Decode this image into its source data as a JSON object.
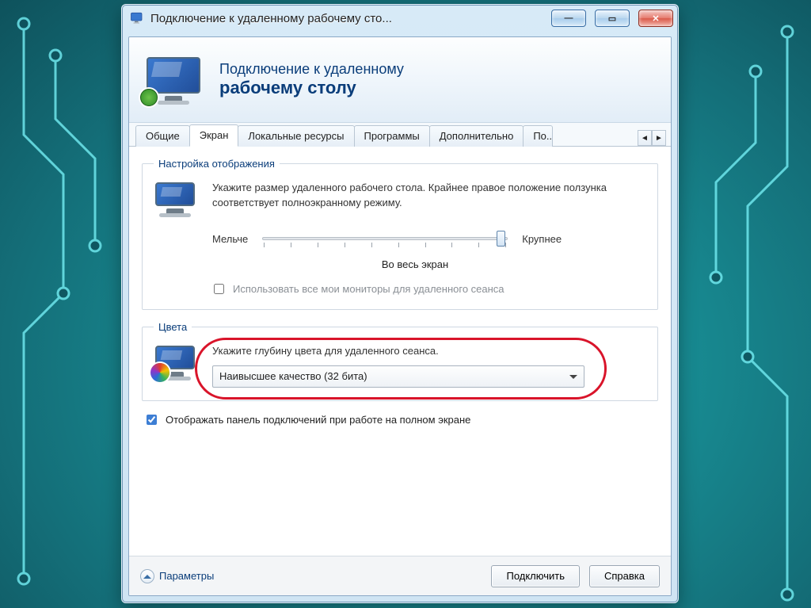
{
  "window": {
    "title": "Подключение к удаленному рабочему сто..."
  },
  "banner": {
    "line1": "Подключение к удаленному",
    "line2": "рабочему столу"
  },
  "tabs": {
    "items": [
      {
        "label": "Общие"
      },
      {
        "label": "Экран"
      },
      {
        "label": "Локальные ресурсы"
      },
      {
        "label": "Программы"
      },
      {
        "label": "Дополнительно"
      },
      {
        "label": "По..."
      }
    ],
    "active_index": 1
  },
  "display_group": {
    "legend": "Настройка отображения",
    "desc": "Укажите размер удаленного рабочего стола. Крайнее правое положение ползунка соответствует полноэкранному режиму.",
    "slider": {
      "label_min": "Мельче",
      "label_max": "Крупнее",
      "readout": "Во весь экран",
      "position_percent": 100
    },
    "all_monitors_label": "Использовать все мои мониторы для удаленного сеанса",
    "all_monitors_checked": false
  },
  "color_group": {
    "legend": "Цвета",
    "desc": "Укажите глубину цвета для удаленного сеанса.",
    "dropdown_value": "Наивысшее качество (32 бита)"
  },
  "show_conn_bar": {
    "label": "Отображать панель подключений при работе на полном экране",
    "checked": true
  },
  "buttons": {
    "options": "Параметры",
    "connect": "Подключить",
    "help": "Справка"
  }
}
